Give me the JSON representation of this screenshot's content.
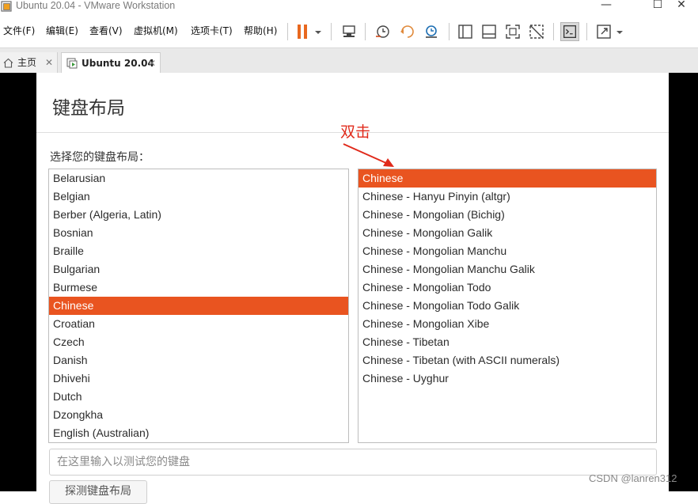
{
  "window": {
    "title": "Ubuntu 20.04 - VMware Workstation",
    "minimize": "—",
    "maximize": "☐",
    "close": "✕"
  },
  "menu": [
    "文件(F)",
    "编辑(E)",
    "查看(V)",
    "虚拟机(M)",
    "选项卡(T)",
    "帮助(H)"
  ],
  "tabs": {
    "home_label": "主页",
    "vm_label": "Ubuntu 20.04",
    "close_glyph": "✕"
  },
  "dialog": {
    "title": "键盘布局",
    "prompt": "选择您的键盘布局：",
    "annotation": "双击",
    "layouts": [
      "Belarusian",
      "Belgian",
      "Berber (Algeria, Latin)",
      "Bosnian",
      "Braille",
      "Bulgarian",
      "Burmese",
      "Chinese",
      "Croatian",
      "Czech",
      "Danish",
      "Dhivehi",
      "Dutch",
      "Dzongkha",
      "English (Australian)"
    ],
    "selected_layout": "Chinese",
    "variants": [
      "Chinese",
      "Chinese - Hanyu Pinyin (altgr)",
      "Chinese - Mongolian (Bichig)",
      "Chinese - Mongolian Galik",
      "Chinese - Mongolian Manchu",
      "Chinese - Mongolian Manchu Galik",
      "Chinese - Mongolian Todo",
      "Chinese - Mongolian Todo Galik",
      "Chinese - Mongolian Xibe",
      "Chinese - Tibetan",
      "Chinese - Tibetan (with ASCII numerals)",
      "Chinese - Uyghur"
    ],
    "selected_variant": "Chinese",
    "test_placeholder": "在这里输入以测试您的键盘",
    "detect_button": "探测键盘布局"
  },
  "watermark": "CSDN @lanren312",
  "colors": {
    "selection": "#e95420",
    "annotation": "#e02a1b",
    "pause_icon": "#e8681f"
  }
}
